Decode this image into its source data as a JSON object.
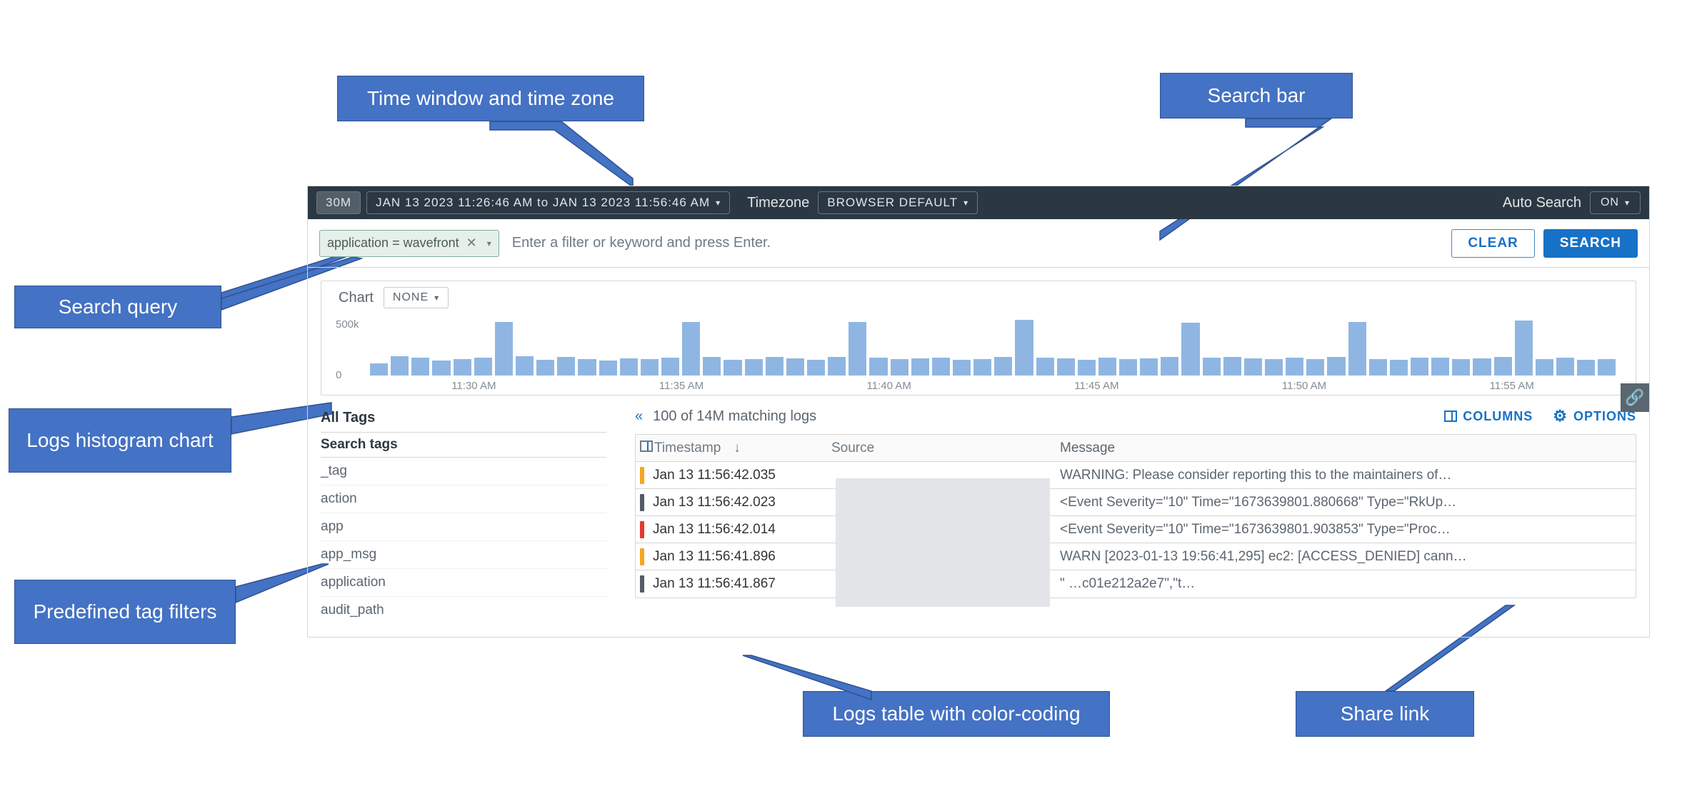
{
  "callouts": {
    "time": "Time window and time zone",
    "searchbar": "Search bar",
    "query": "Search query",
    "hist": "Logs histogram chart",
    "tags": "Predefined tag filters",
    "table": "Logs table with color-coding",
    "share": "Share link"
  },
  "topbar": {
    "range_btn": "30M",
    "range_text": "JAN 13 2023 11:26:46 AM  to  JAN 13 2023 11:56:46 AM",
    "tz_label": "Timezone",
    "tz_value": "BROWSER DEFAULT",
    "auto_label": "Auto Search",
    "auto_value": "ON"
  },
  "search": {
    "chip": "application = wavefront",
    "placeholder": "Enter a filter or keyword and press Enter.",
    "clear": "CLEAR",
    "search": "SEARCH"
  },
  "chart": {
    "label": "Chart",
    "select": "NONE",
    "yticks": [
      "500k",
      "0"
    ],
    "xticks": [
      "11:30 AM",
      "11:35 AM",
      "11:40 AM",
      "11:45 AM",
      "11:50 AM",
      "11:55 AM"
    ]
  },
  "chart_data": {
    "type": "bar",
    "title": "",
    "ylabel": "",
    "xlabel": "",
    "ylim": [
      0,
      700000
    ],
    "yticks": [
      0,
      500000
    ],
    "x_start": "11:26:46 AM",
    "x_end": "11:56:46 AM",
    "x_tick_labels": [
      "11:30 AM",
      "11:35 AM",
      "11:40 AM",
      "11:45 AM",
      "11:50 AM",
      "11:55 AM"
    ],
    "values": [
      150000,
      240000,
      220000,
      180000,
      200000,
      220000,
      660000,
      240000,
      190000,
      230000,
      200000,
      180000,
      210000,
      200000,
      220000,
      660000,
      230000,
      190000,
      200000,
      230000,
      210000,
      190000,
      225000,
      660000,
      220000,
      200000,
      210000,
      220000,
      190000,
      200000,
      225000,
      680000,
      220000,
      210000,
      195000,
      215000,
      200000,
      210000,
      230000,
      650000,
      220000,
      225000,
      210000,
      200000,
      215000,
      205000,
      225000,
      660000,
      200000,
      190000,
      220000,
      215000,
      200000,
      210000,
      225000,
      670000,
      205000,
      215000,
      195000,
      200000
    ]
  },
  "tags": {
    "all": "All Tags",
    "search": "Search tags",
    "items": [
      "_tag",
      "action",
      "app",
      "app_msg",
      "application",
      "audit_path"
    ]
  },
  "logs": {
    "count": "100 of 14M matching logs",
    "columns_btn": "COLUMNS",
    "options_btn": "OPTIONS",
    "headers": {
      "ts": "Timestamp",
      "src": "Source",
      "msg": "Message"
    },
    "rows": [
      {
        "color": "#f5a623",
        "ts": "Jan 13 11:56:42.035",
        "msg": "WARNING: Please consider reporting this to the maintainers of…"
      },
      {
        "color": "#555c66",
        "ts": "Jan 13 11:56:42.023",
        "msg": "<Event Severity=\"10\" Time=\"1673639801.880668\" Type=\"RkUp…"
      },
      {
        "color": "#e33b2e",
        "ts": "Jan 13 11:56:42.014",
        "msg": "<Event Severity=\"10\" Time=\"1673639801.903853\" Type=\"Proc…"
      },
      {
        "color": "#f5a623",
        "ts": "Jan 13 11:56:41.896",
        "msg": "WARN [2023-01-13 19:56:41,295] ec2: [ACCESS_DENIED] cann…"
      },
      {
        "color": "#555c66",
        "ts": "Jan 13 11:56:41.867",
        "msg": "\"                                                                                                 …c01e212a2e7\",\"t…"
      }
    ]
  }
}
